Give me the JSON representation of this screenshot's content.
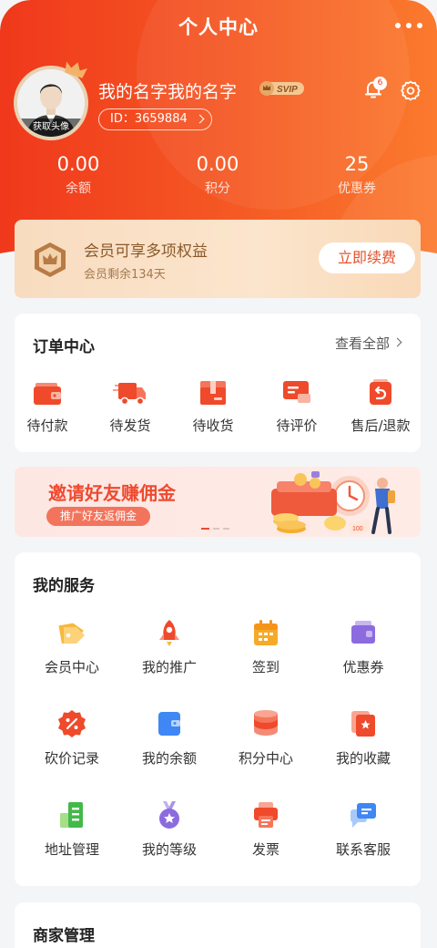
{
  "header": {
    "title": "个人中心",
    "more_icon": "more-dots-icon",
    "avatar_caption": "获取头像",
    "username": "我的名字我的名字",
    "vip_badge": "SVIP",
    "user_id": "ID：3659884",
    "notification_count": "6",
    "colors": {
      "gradient_start": "#f0381c",
      "gradient_end": "#fb7a2e"
    }
  },
  "stats": [
    {
      "value": "0.00",
      "label": "余额"
    },
    {
      "value": "0.00",
      "label": "积分"
    },
    {
      "value": "25",
      "label": "优惠券"
    }
  ],
  "member": {
    "title": "会员可享多项权益",
    "subtitle": "会员剩余134天",
    "button": "立即续费"
  },
  "orders": {
    "title": "订单中心",
    "view_all": "查看全部",
    "items": [
      {
        "label": "待付款",
        "icon": "wallet-icon"
      },
      {
        "label": "待发货",
        "icon": "delivery-truck-icon"
      },
      {
        "label": "待收货",
        "icon": "package-box-icon"
      },
      {
        "label": "待评价",
        "icon": "review-message-icon"
      },
      {
        "label": "售后/退款",
        "icon": "refund-icon"
      }
    ]
  },
  "invite": {
    "title": "邀请好友赚佣金",
    "tag": "推广好友返佣金",
    "art_value": "100"
  },
  "services": {
    "title": "我的服务",
    "items": [
      {
        "label": "会员中心",
        "icon": "member-tag-icon"
      },
      {
        "label": "我的推广",
        "icon": "rocket-icon"
      },
      {
        "label": "签到",
        "icon": "calendar-icon"
      },
      {
        "label": "优惠券",
        "icon": "coupon-icon"
      },
      {
        "label": "砍价记录",
        "icon": "discount-badge-icon"
      },
      {
        "label": "我的余额",
        "icon": "balance-wallet-icon"
      },
      {
        "label": "积分中心",
        "icon": "coin-stack-icon"
      },
      {
        "label": "我的收藏",
        "icon": "favorite-star-icon"
      },
      {
        "label": "地址管理",
        "icon": "address-building-icon"
      },
      {
        "label": "我的等级",
        "icon": "level-medal-icon"
      },
      {
        "label": "发票",
        "icon": "invoice-printer-icon"
      },
      {
        "label": "联系客服",
        "icon": "customer-service-chat-icon"
      }
    ]
  },
  "merchant": {
    "title": "商家管理"
  }
}
